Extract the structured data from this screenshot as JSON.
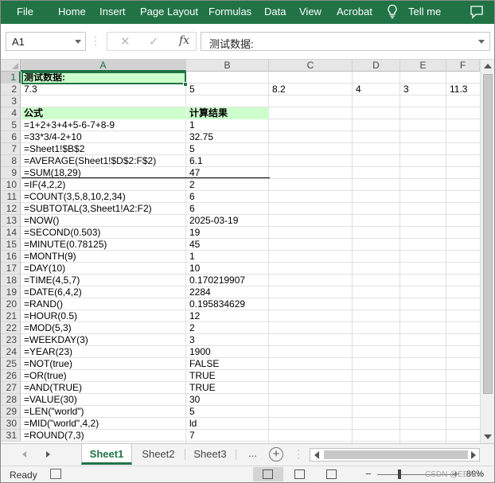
{
  "ribbon": {
    "tabs": [
      "File",
      "Home",
      "Insert",
      "Page Layout",
      "Formulas",
      "Data",
      "View",
      "Acrobat"
    ],
    "tell_me": "Tell me"
  },
  "formula_bar": {
    "name_box": "A1",
    "cancel_icon": "✕",
    "enter_icon": "✓",
    "fx_label": "fx",
    "value": "测试数据:"
  },
  "grid": {
    "columns": [
      "A",
      "B",
      "C",
      "D",
      "E",
      "F"
    ],
    "rows": [
      "1",
      "2",
      "3",
      "4",
      "5",
      "6",
      "7",
      "8",
      "9",
      "10",
      "11",
      "12",
      "13",
      "14",
      "15",
      "16",
      "17",
      "18",
      "19",
      "20",
      "21",
      "22",
      "23",
      "24",
      "25",
      "26",
      "27",
      "28",
      "29",
      "30",
      "31"
    ],
    "cells": {
      "r1": [
        "测试数据:"
      ],
      "r2": [
        "7.3",
        "5",
        "8.2",
        "4",
        "3",
        "11.3"
      ],
      "r4": [
        "公式",
        "计算结果"
      ],
      "data": [
        [
          "=1+2+3+4+5-6-7+8-9",
          "1"
        ],
        [
          "=33*3/4-2+10",
          "32.75"
        ],
        [
          "=Sheet1!$B$2",
          "5"
        ],
        [
          "=AVERAGE(Sheet1!$D$2:F$2)",
          "6.1"
        ],
        [
          "=SUM(18,29)",
          "47"
        ],
        [
          "=IF(4,2,2)",
          "2"
        ],
        [
          "=COUNT(3,5,8,10,2,34)",
          "6"
        ],
        [
          "=SUBTOTAL(3,Sheet1!A2:F2)",
          "6"
        ],
        [
          "=NOW()",
          "2025-03-19"
        ],
        [
          "=SECOND(0.503)",
          "19"
        ],
        [
          "=MINUTE(0.78125)",
          "45"
        ],
        [
          "=MONTH(9)",
          "1"
        ],
        [
          "=DAY(10)",
          "10"
        ],
        [
          "=TIME(4,5,7)",
          "0.170219907"
        ],
        [
          "=DATE(6,4,2)",
          "2284"
        ],
        [
          "=RAND()",
          "0.195834629"
        ],
        [
          "=HOUR(0.5)",
          "12"
        ],
        [
          "=MOD(5,3)",
          "2"
        ],
        [
          "=WEEKDAY(3)",
          "3"
        ],
        [
          "=YEAR(23)",
          "1900"
        ],
        [
          "=NOT(true)",
          "FALSE"
        ],
        [
          "=OR(true)",
          "TRUE"
        ],
        [
          "=AND(TRUE)",
          "TRUE"
        ],
        [
          "=VALUE(30)",
          "30"
        ],
        [
          "=LEN(\"world\")",
          "5"
        ],
        [
          "=MID(\"world\",4,2)",
          "ld"
        ],
        [
          "=ROUND(7,3)",
          "7"
        ]
      ]
    }
  },
  "sheet_tabs": {
    "tabs": [
      "Sheet1",
      "Sheet2",
      "Sheet3"
    ],
    "active": "Sheet1",
    "more": "...",
    "add": "+"
  },
  "status_bar": {
    "ready": "Ready",
    "zoom_minus": "−",
    "zoom_plus": "+",
    "zoom_percent": "89%",
    "watermark": "CSDN @EBNue"
  },
  "colors": {
    "ribbon": "#217346",
    "header_fill": "#ccffcc",
    "selection": "#217346"
  }
}
